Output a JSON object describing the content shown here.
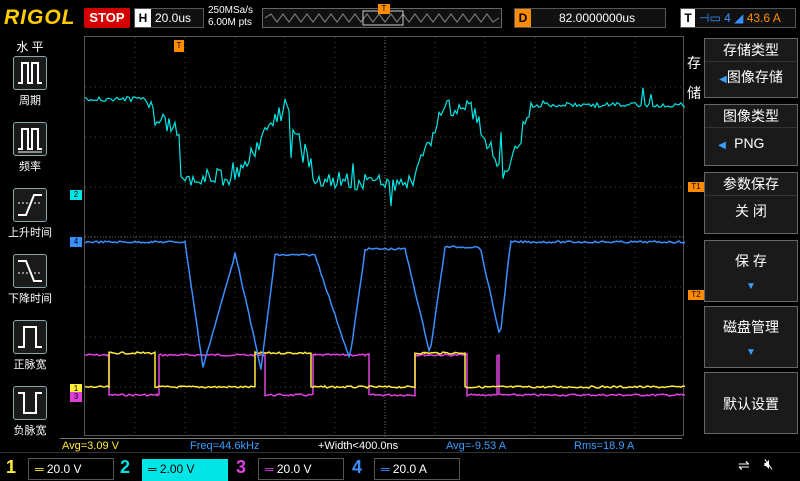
{
  "header": {
    "brand": "RIGOL",
    "run_state": "STOP",
    "horizontal_label": "H",
    "timebase": "20.0us",
    "sample_rate": "250MSa/s",
    "memory_depth": "6.00M pts",
    "delay_label": "D",
    "delay_value": "82.0000000us",
    "trigger_label": "T",
    "trigger_level": "43.6 A",
    "trigger_marker": "T"
  },
  "left_menu": {
    "title": "水 平",
    "items": [
      {
        "label": "周期",
        "icon": "period-icon"
      },
      {
        "label": "频率",
        "icon": "frequency-icon"
      },
      {
        "label": "上升时间",
        "icon": "rise-time-icon"
      },
      {
        "label": "下降时间",
        "icon": "fall-time-icon"
      },
      {
        "label": "正脉宽",
        "icon": "positive-width-icon"
      },
      {
        "label": "负脉宽",
        "icon": "negative-width-icon"
      }
    ]
  },
  "right_menu": {
    "vertical_title": "存 储",
    "storage_type_label": "存储类型",
    "storage_type_value": "图像存储",
    "image_type_label": "图像类型",
    "image_type_value": "PNG",
    "param_save_label": "参数保存",
    "param_save_value": "关 闭",
    "save_label": "保 存",
    "disk_label": "磁盘管理",
    "default_label": "默认设置"
  },
  "markers": {
    "ch2": "2",
    "ch4": "4",
    "ch1": "1",
    "ch3": "3",
    "t1": "T1",
    "t2": "T2",
    "trig_pos": "T"
  },
  "measurements": [
    {
      "text": "Avg=3.09 V",
      "color": "#ffeb3b"
    },
    {
      "text": "Freq=44.6kHz",
      "color": "#3aa0ff"
    },
    {
      "text": "+Width<400.0ns",
      "color": "#ffffff"
    },
    {
      "text": "Avg=-9.53 A",
      "color": "#3aa0ff"
    },
    {
      "text": "Rms=18.9 A",
      "color": "#3aa0ff"
    }
  ],
  "channels": [
    {
      "num": "1",
      "scale": "20.0 V",
      "color": "#ffeb3b"
    },
    {
      "num": "2",
      "scale": "2.00 V",
      "color": "#00e5e5"
    },
    {
      "num": "3",
      "scale": "20.0 V",
      "color": "#e040e0"
    },
    {
      "num": "4",
      "scale": "20.0 A",
      "color": "#3a8fff"
    }
  ],
  "colors": {
    "ch1": "#ffeb3b",
    "ch2": "#00e5e5",
    "ch3": "#e040e0",
    "ch4": "#3a8fff",
    "trigger": "#ff8c00"
  }
}
